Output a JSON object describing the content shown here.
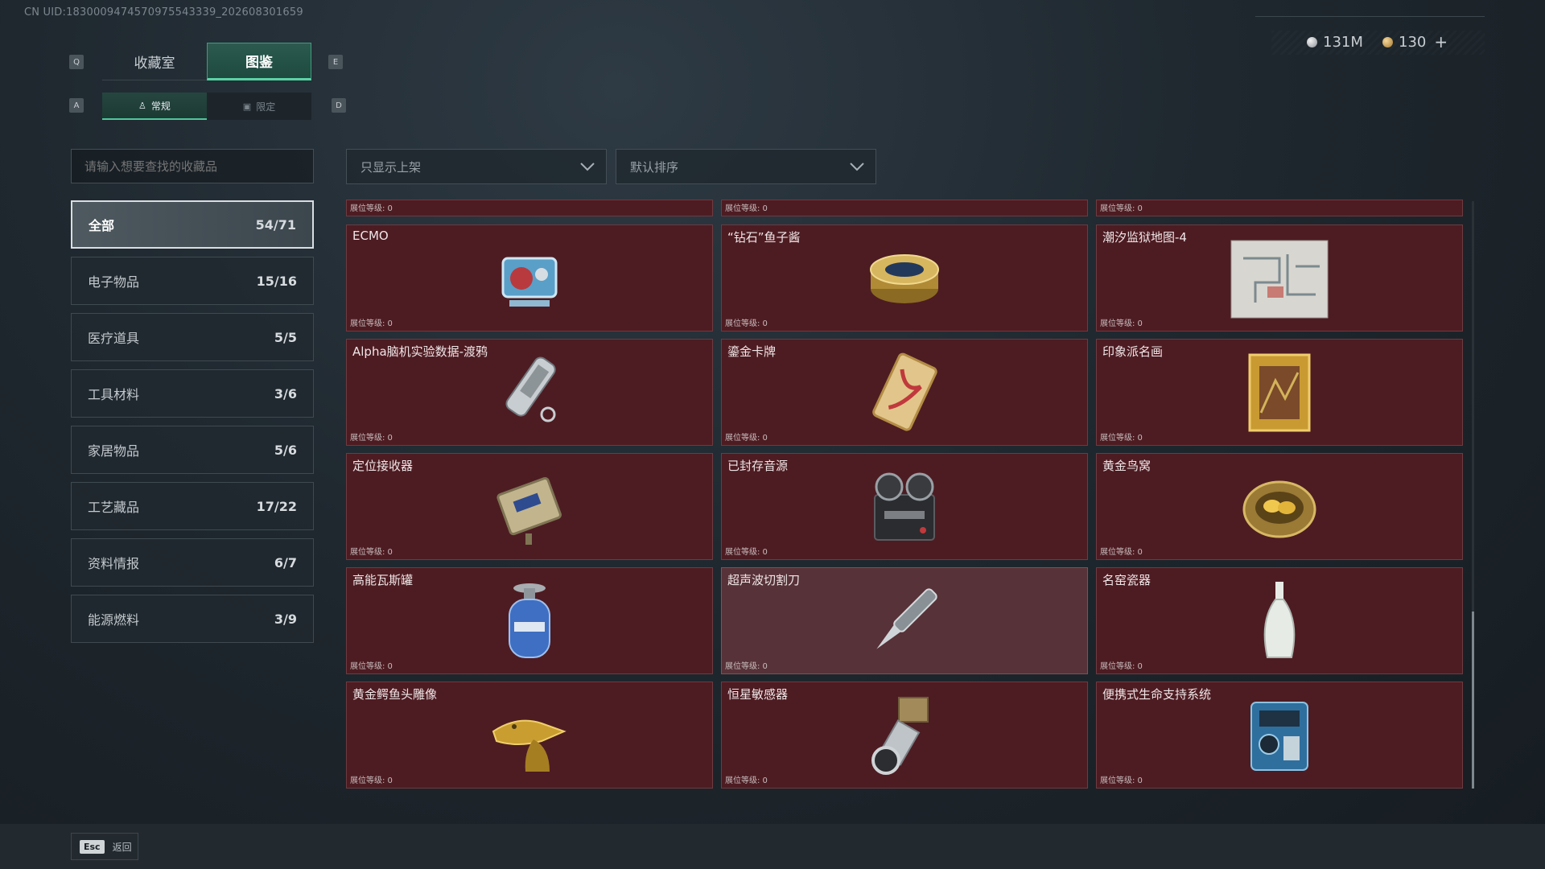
{
  "uid_text": "CN UID:1830009474570975543339_202608301659",
  "hotkeys": {
    "prev_tab": "Q",
    "next_tab": "E",
    "prev_sub": "A",
    "next_sub": "D"
  },
  "tabs": [
    {
      "label": "收藏室",
      "active": false
    },
    {
      "label": "图鉴",
      "active": true
    }
  ],
  "sub_tabs": [
    {
      "label": "常规",
      "icon": "figure-icon",
      "active": true
    },
    {
      "label": "限定",
      "icon": "image-icon",
      "active": false
    }
  ],
  "currency": {
    "silver": "131M",
    "gold": "130",
    "add": "+"
  },
  "search": {
    "placeholder": "请输入想要查找的收藏品"
  },
  "filters": {
    "shelf_filter": "只显示上架",
    "sort": "默认排序"
  },
  "categories": [
    {
      "label": "全部",
      "count": "54/71",
      "active": true
    },
    {
      "label": "电子物品",
      "count": "15/16"
    },
    {
      "label": "医疗道具",
      "count": "5/5"
    },
    {
      "label": "工具材料",
      "count": "3/6"
    },
    {
      "label": "家居物品",
      "count": "5/6"
    },
    {
      "label": "工艺藏品",
      "count": "17/22"
    },
    {
      "label": "资料情报",
      "count": "6/7"
    },
    {
      "label": "能源燃料",
      "count": "3/9"
    }
  ],
  "level_label": "展位等级: 0",
  "items": [
    {
      "name": "ECMO",
      "icon": "ecmo-machine-icon"
    },
    {
      "name": "“钻石”鱼子酱",
      "icon": "caviar-tin-icon"
    },
    {
      "name": "潮汐监狱地图-4",
      "icon": "prison-map-icon"
    },
    {
      "name": "Alpha脑机实验数据-渡鸦",
      "icon": "data-drive-icon"
    },
    {
      "name": "鎏金卡牌",
      "icon": "gilded-card-icon"
    },
    {
      "name": "印象派名画",
      "icon": "framed-painting-icon"
    },
    {
      "name": "定位接收器",
      "icon": "locator-receiver-icon"
    },
    {
      "name": "已封存音源",
      "icon": "reel-recorder-icon"
    },
    {
      "name": "黄金鸟窝",
      "icon": "golden-nest-icon"
    },
    {
      "name": "高能瓦斯罐",
      "icon": "gas-canister-icon"
    },
    {
      "name": "超声波切割刀",
      "icon": "ultrasonic-cutter-icon",
      "highlighted": true
    },
    {
      "name": "名窑瓷器",
      "icon": "porcelain-vase-icon"
    },
    {
      "name": "黄金鳄鱼头雕像",
      "icon": "golden-crocodile-icon"
    },
    {
      "name": "恒星敏感器",
      "icon": "star-sensor-icon"
    },
    {
      "name": "便携式生命支持系统",
      "icon": "life-support-icon"
    }
  ],
  "back": {
    "key": "Esc",
    "label": "返回"
  }
}
